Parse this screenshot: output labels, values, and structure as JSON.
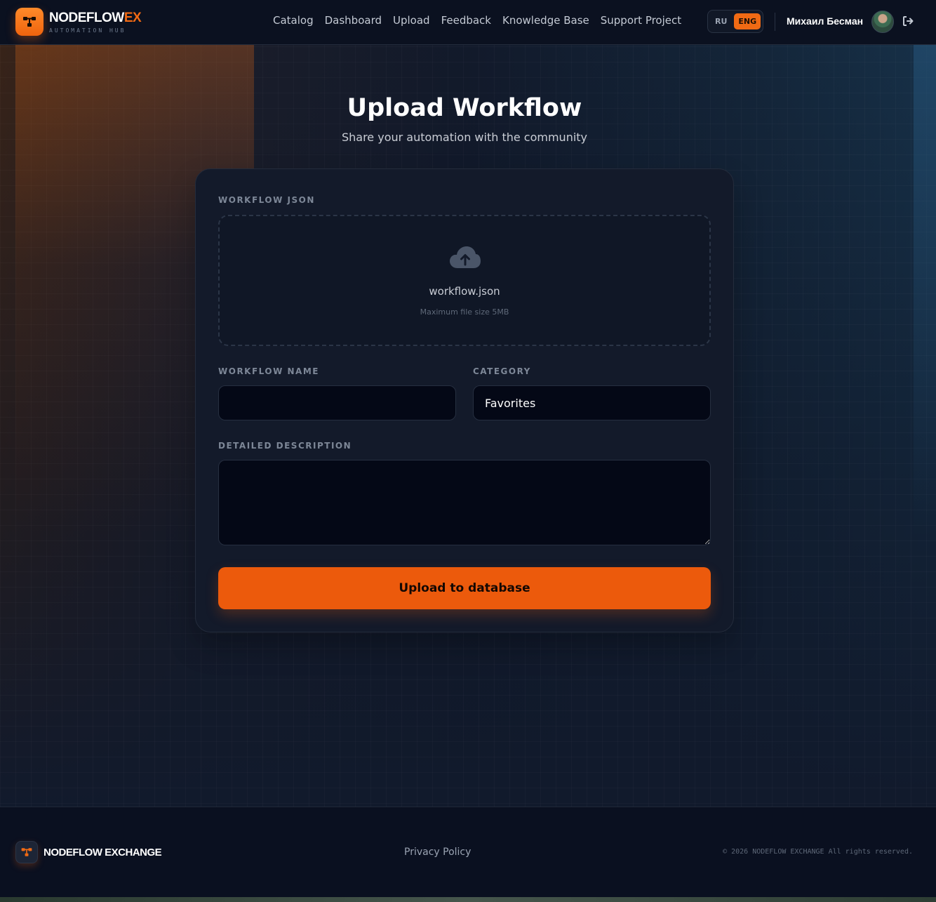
{
  "brand": {
    "name_main": "NODEFLOW",
    "name_accent": "EX",
    "tagline": "AUTOMATION HUB"
  },
  "nav": {
    "items": [
      {
        "label": "Catalog"
      },
      {
        "label": "Dashboard"
      },
      {
        "label": "Upload"
      },
      {
        "label": "Feedback"
      },
      {
        "label": "Knowledge Base"
      },
      {
        "label": "Support Project"
      }
    ]
  },
  "language": {
    "options": [
      "RU",
      "ENG"
    ],
    "selected": "ENG"
  },
  "user": {
    "name": "Михаил Бесман"
  },
  "page": {
    "title": "Upload Workflow",
    "subtitle": "Share your automation with the community"
  },
  "form": {
    "json_label": "WORKFLOW JSON",
    "file_name": "workflow.json",
    "file_hint": "Maximum file size 5MB",
    "name_label": "WORKFLOW NAME",
    "name_value": "",
    "category_label": "CATEGORY",
    "category_value": "Favorites",
    "description_label": "DETAILED DESCRIPTION",
    "description_value": "",
    "submit_label": "Upload to database"
  },
  "footer": {
    "brand": "NODEFLOW EXCHANGE",
    "privacy": "Privacy Policy",
    "copyright": "© 2026 NODEFLOW EXCHANGE All rights reserved."
  },
  "colors": {
    "accent": "#f06a14",
    "background": "#0e1525",
    "card": "#131a2a"
  },
  "icons": {
    "logo": "workflow-nodes-icon",
    "upload": "cloud-upload-icon",
    "logout": "logout-icon"
  }
}
